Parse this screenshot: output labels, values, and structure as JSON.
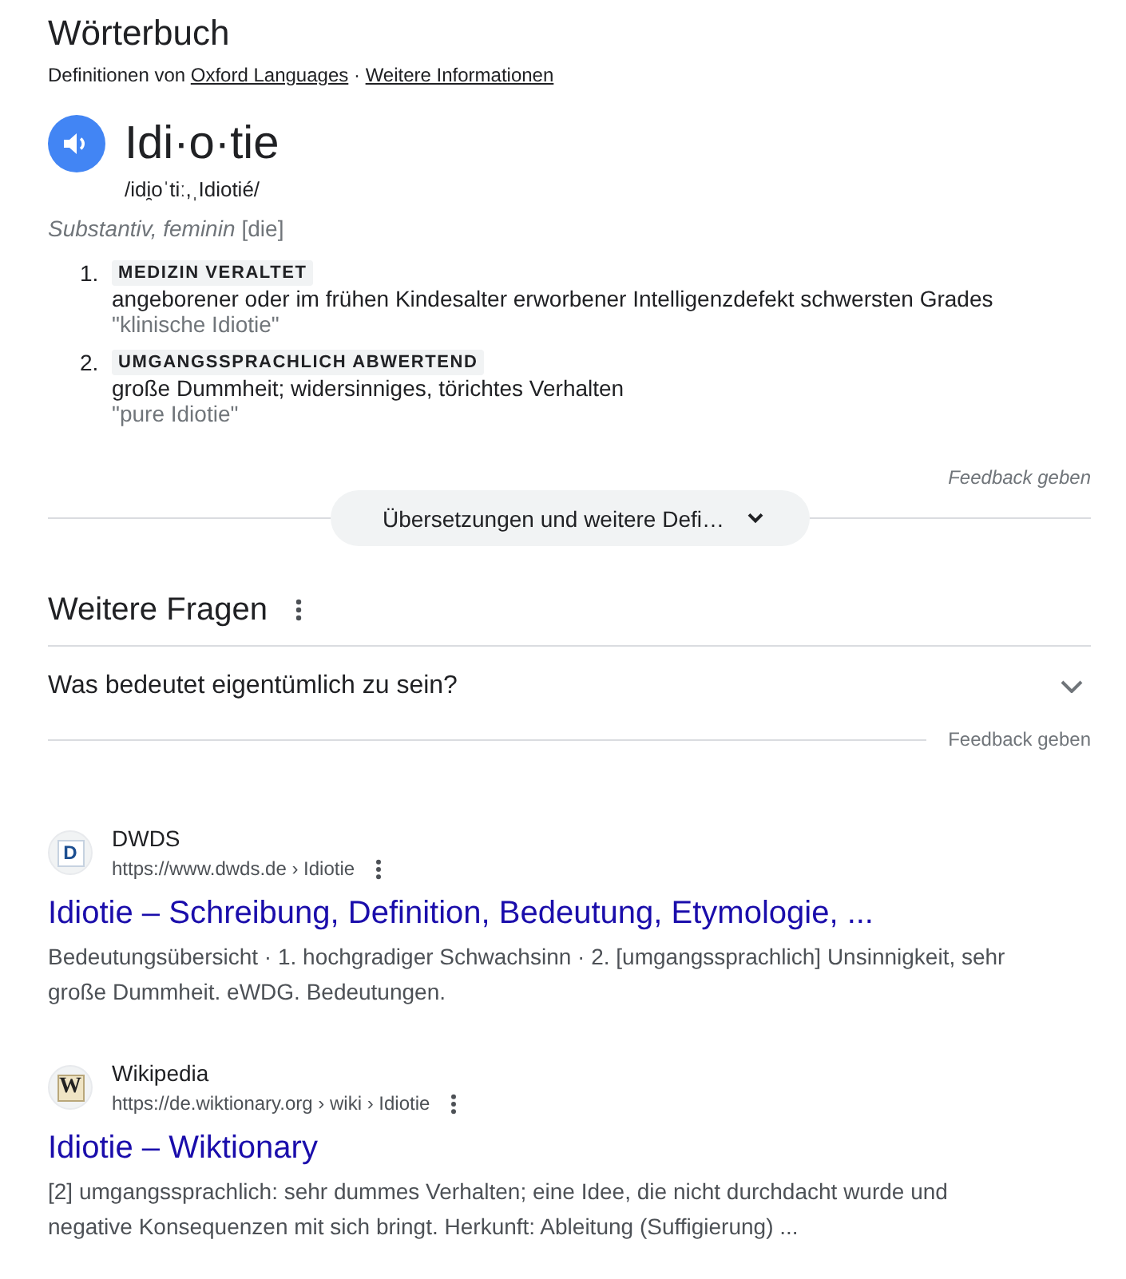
{
  "dictionary": {
    "heading": "Wörterbuch",
    "attribution": {
      "text": "Definitionen von",
      "source_link": "Oxford Languages",
      "separator": "·",
      "more_link": "Weitere Informationen"
    },
    "word": "Idi·o·tie",
    "pronunciation": "/idi̯oˈtiː,ˌIdiotié/",
    "part_of_speech": "Substantiv, feminin",
    "article": "[die]",
    "senses": [
      {
        "number": "1.",
        "label": "MEDIZIN VERALTET",
        "definition": "angeborener oder im frühen Kindesalter erworbener Intelligenzdefekt schwersten Grades",
        "example": "\"klinische Idiotie\""
      },
      {
        "number": "2.",
        "label": "UMGANGSSPRACHLICH ABWERTEND",
        "definition": "große Dummheit; widersinniges, törichtes Verhalten",
        "example": "\"pure Idiotie\""
      }
    ],
    "feedback": "Feedback geben",
    "more_button": "Übersetzungen und weitere Defi…"
  },
  "related_questions": {
    "heading": "Weitere Fragen",
    "questions": [
      {
        "text": "Was bedeutet eigentümlich zu sein?",
        "expanded": false
      }
    ],
    "feedback": "Feedback geben"
  },
  "results": [
    {
      "logo": {
        "kind": "square",
        "letter": "D"
      },
      "site_name": "DWDS",
      "url": "https://www.dwds.de › Idiotie",
      "title": "Idiotie – Schreibung, Definition, Bedeutung, Etymologie, ...",
      "snippet": "Bedeutungsübersicht · 1. hochgradiger Schwachsinn · 2. [umgangssprachlich] Unsinnigkeit, sehr große Dummheit. eWDG. Bedeutungen."
    },
    {
      "logo": {
        "kind": "tile",
        "letter": "W"
      },
      "site_name": "Wikipedia",
      "url": "https://de.wiktionary.org › wiki › Idiotie",
      "title": "Idiotie – Wiktionary",
      "snippet": "[2] umgangssprachlich: sehr dummes Verhalten; eine Idee, die nicht durchdacht wurde und negative Konsequenzen mit sich bringt. Herkunft: Ableitung (Suffigierung) ..."
    }
  ]
}
